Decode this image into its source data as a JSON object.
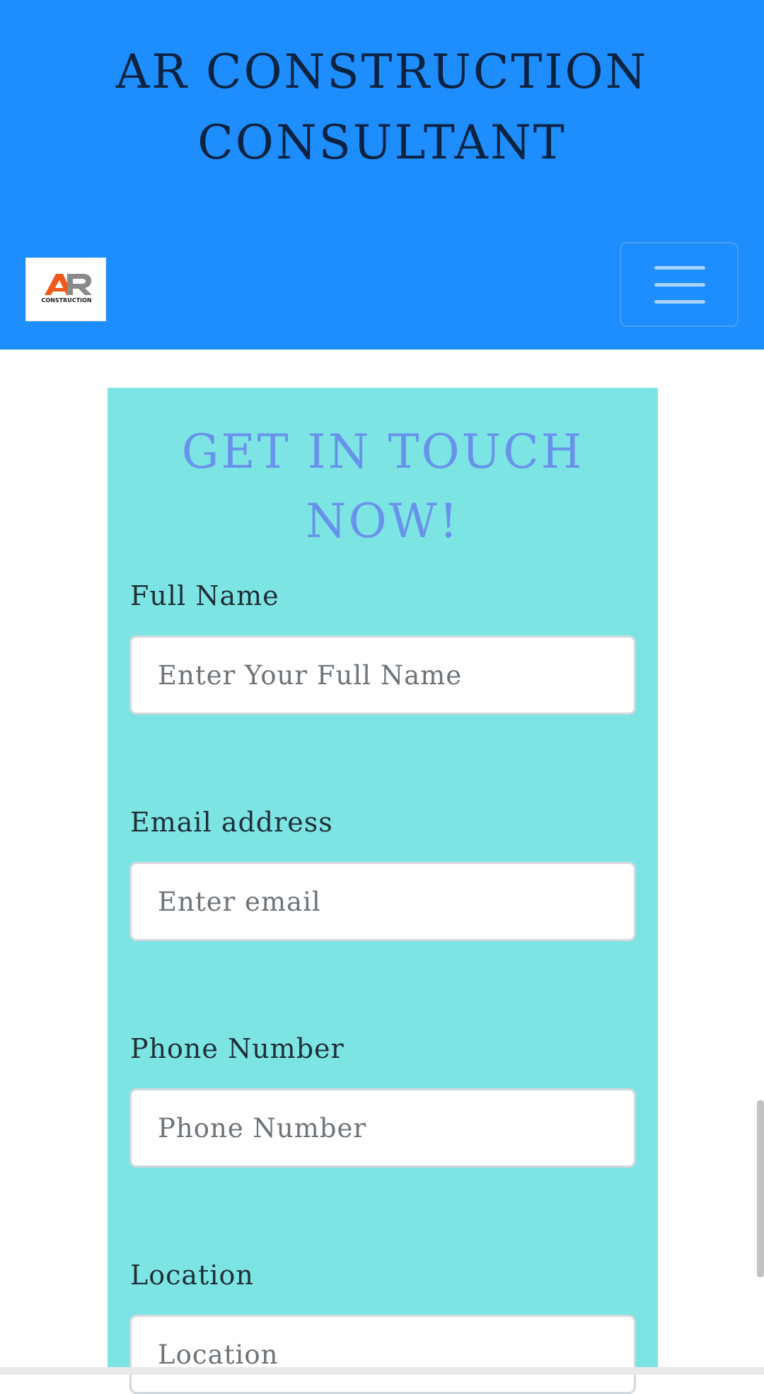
{
  "header": {
    "title_line1": "AR CONSTRUCTION",
    "title_line2": "CONSULTANT",
    "logo": {
      "mark_text": "AR",
      "subtitle": "CONSTRUCTION",
      "colors": {
        "a": "#ef5a1c",
        "r": "#8a8a8a"
      }
    },
    "menu_icon": "hamburger-menu-icon",
    "background_color": "#1e8dfd"
  },
  "contact_form": {
    "title_line1": "GET IN TOUCH",
    "title_line2": "NOW!",
    "background_color": "#7de4e4",
    "title_color": "#6893ea",
    "fields": [
      {
        "label": "Full Name",
        "placeholder": "Enter Your Full Name",
        "value": ""
      },
      {
        "label": "Email address",
        "placeholder": "Enter email",
        "value": ""
      },
      {
        "label": "Phone Number",
        "placeholder": "Phone Number",
        "value": ""
      },
      {
        "label": "Location",
        "placeholder": "Location",
        "value": ""
      }
    ]
  }
}
